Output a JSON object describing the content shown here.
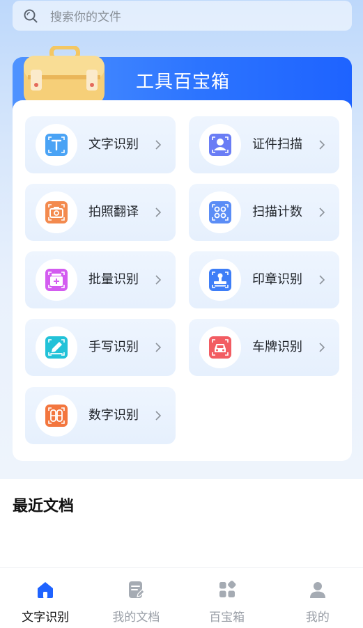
{
  "search": {
    "placeholder": "搜索你的文件"
  },
  "banner": {
    "title": "工具百宝箱"
  },
  "tools": [
    {
      "label": "文字识别",
      "icon": "text-recognition-icon",
      "color": "#4aa3f5"
    },
    {
      "label": "证件扫描",
      "icon": "id-scan-icon",
      "color": "#6a7df5"
    },
    {
      "label": "拍照翻译",
      "icon": "photo-translate-icon",
      "color": "#f38a4e"
    },
    {
      "label": "扫描计数",
      "icon": "scan-count-icon",
      "color": "#5b8df6"
    },
    {
      "label": "批量识别",
      "icon": "batch-recognition-icon",
      "color": "#d35cf0"
    },
    {
      "label": "印章识别",
      "icon": "seal-recognition-icon",
      "color": "#3e7ef7"
    },
    {
      "label": "手写识别",
      "icon": "handwriting-recognition-icon",
      "color": "#22c2d8"
    },
    {
      "label": "车牌识别",
      "icon": "license-plate-icon",
      "color": "#f25c62"
    },
    {
      "label": "数字识别",
      "icon": "digit-recognition-icon",
      "color": "#f3763e"
    }
  ],
  "recent": {
    "title": "最近文档"
  },
  "tabs": [
    {
      "label": "文字识别",
      "icon": "home-icon",
      "active": true
    },
    {
      "label": "我的文档",
      "icon": "document-icon",
      "active": false
    },
    {
      "label": "百宝箱",
      "icon": "toolbox-grid-icon",
      "active": false
    },
    {
      "label": "我的",
      "icon": "user-icon",
      "active": false
    }
  ],
  "colors": {
    "accent": "#1f63ff",
    "tab_active": "#1f63ff",
    "tab_inactive": "#a5abb3"
  }
}
